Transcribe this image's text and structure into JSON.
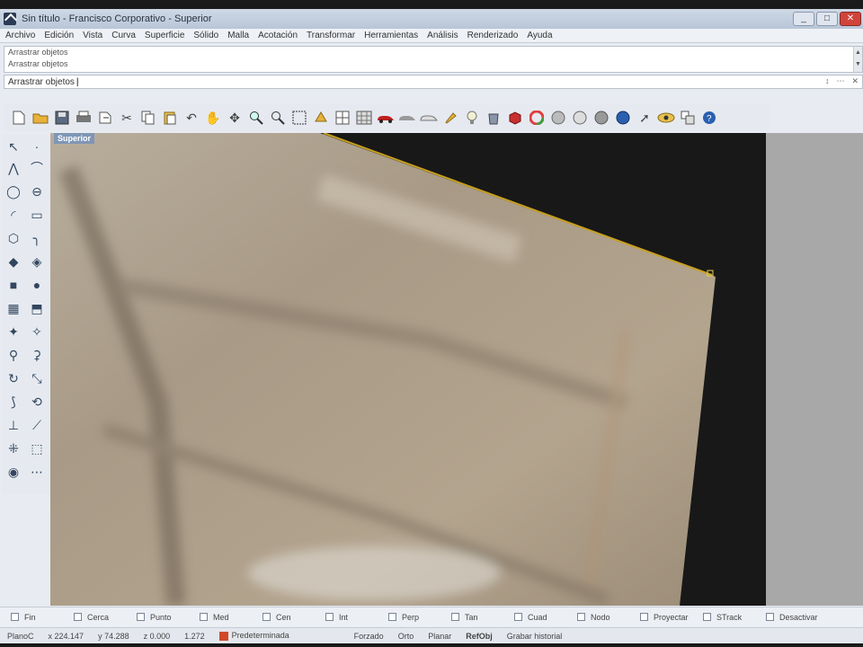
{
  "window": {
    "title": "Sin título - Francisco Corporativo - Superior"
  },
  "window_controls": {
    "minimize": "_",
    "maximize": "□",
    "close": "✕"
  },
  "menu": [
    "Archivo",
    "Edición",
    "Vista",
    "Curva",
    "Superficie",
    "Sólido",
    "Malla",
    "Acotación",
    "Transformar",
    "Herramientas",
    "Análisis",
    "Renderizado",
    "Ayuda"
  ],
  "command_history": [
    "Arrastrar objetos",
    "Arrastrar objetos"
  ],
  "command_line": {
    "prompt": "Arrastrar objetos"
  },
  "toolbar_icons": [
    "new-file-icon",
    "open-folder-icon",
    "save-icon",
    "print-icon",
    "import-icon",
    "cut-icon",
    "copy-icon",
    "paste-icon",
    "undo-icon",
    "pan-hand-icon",
    "move-icon",
    "zoom-icon",
    "zoom-window-icon",
    "zoom-extents-icon",
    "rotate-view-icon",
    "four-views-icon",
    "grid-icon",
    "car-icon",
    "shaded-icon",
    "wireframe-icon",
    "highlighter-icon",
    "light-bulb-icon",
    "bucket-icon",
    "render-icon",
    "color-wheel-icon",
    "sphere-icon",
    "sphere-outline-icon",
    "sphere-grey-icon",
    "globe-icon",
    "arrow-icon",
    "eye-icon",
    "options-icon",
    "help-icon"
  ],
  "viewport": {
    "label": "Superior"
  },
  "osnaps": [
    "Fin",
    "Cerca",
    "Punto",
    "Med",
    "Cen",
    "Int",
    "Perp",
    "Tan",
    "Cuad",
    "Nodo",
    "Proyectar",
    "STrack",
    "Desactivar"
  ],
  "status": {
    "plane": "PlanoC",
    "x": "x 224.147",
    "y": "y 74.288",
    "z": "z 0.000",
    "units": "1.272",
    "layer": "Predeterminada",
    "modes": [
      "Forzado",
      "Orto",
      "Planar"
    ],
    "active_mode": "RefObj",
    "history": "Grabar historial"
  },
  "colors": {
    "accent": "#7f96b5",
    "layer_color": "#d04a2a",
    "line_highlight": "#c8a020"
  }
}
